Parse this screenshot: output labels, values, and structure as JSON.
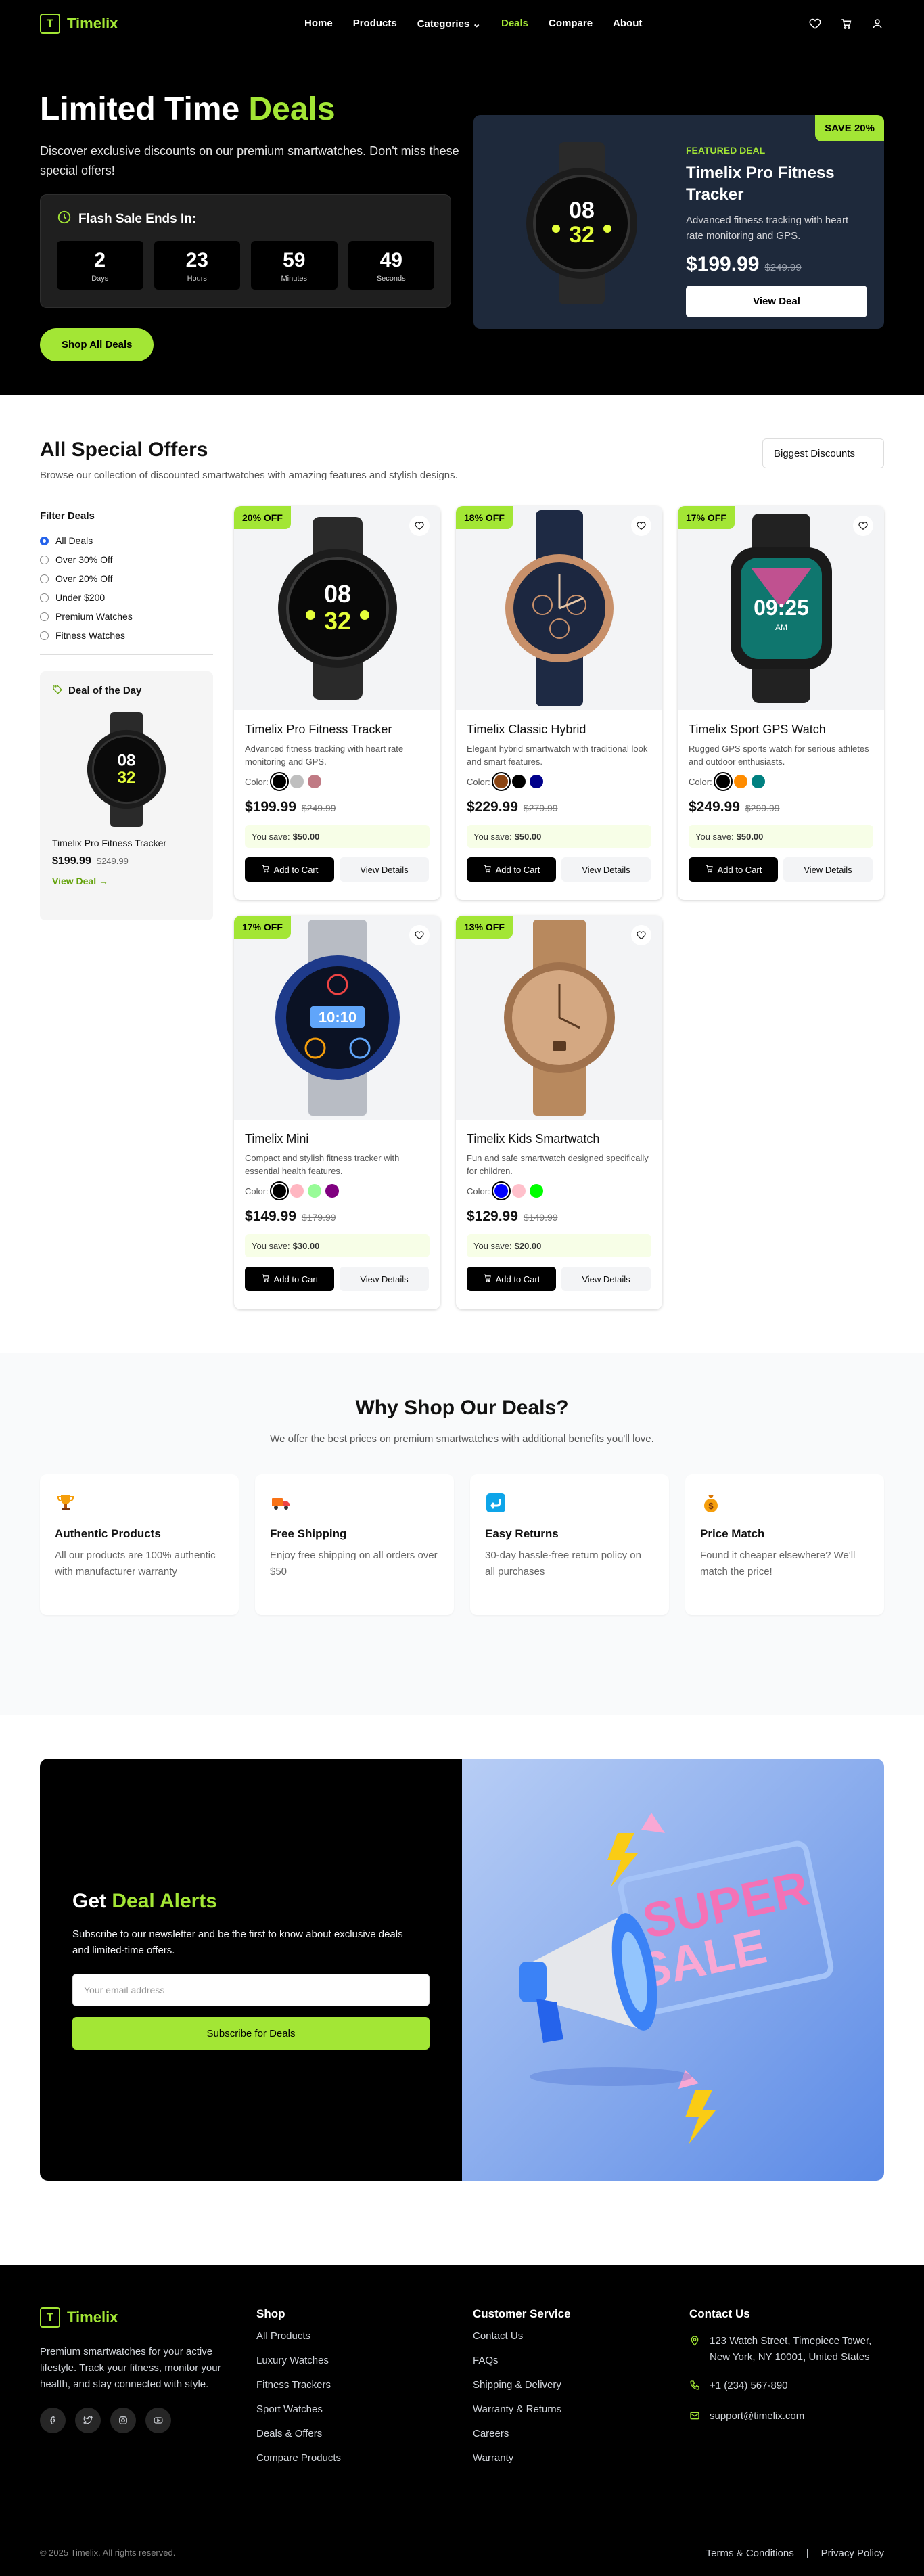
{
  "brand": {
    "logo_letter": "T",
    "name": "Timelix",
    "accent": "#a3e635"
  },
  "nav": {
    "links": [
      "Home",
      "Products",
      "Categories",
      "Deals",
      "Compare",
      "About"
    ],
    "active": "Deals",
    "icons": [
      "heart-icon",
      "cart-icon",
      "user-icon"
    ]
  },
  "hero": {
    "title_part1": "Limited Time",
    "title_part2": "Deals",
    "description": "Discover exclusive discounts on our premium smartwatches. Don't miss these special offers!",
    "timer_title": "Flash Sale Ends In:",
    "timer": [
      {
        "value": "2",
        "label": "Days"
      },
      {
        "value": "23",
        "label": "Hours"
      },
      {
        "value": "59",
        "label": "Minutes"
      },
      {
        "value": "49",
        "label": "Seconds"
      }
    ],
    "cta": "Shop All Deals",
    "featured": {
      "badge": "SAVE 20%",
      "tag": "FEATURED DEAL",
      "name": "Timelix Pro Fitness Tracker",
      "description": "Advanced fitness tracking with heart rate monitoring and GPS.",
      "price": "$199.99",
      "old_price": "$249.99",
      "button": "View Deal"
    }
  },
  "offers": {
    "title": "All Special Offers",
    "subtitle": "Browse our collection of discounted smartwatches with amazing features and stylish designs.",
    "sort_label": "Biggest Discounts",
    "filters": {
      "title": "Filter Deals",
      "options": [
        "All Deals",
        "Over 30% Off",
        "Over 20% Off",
        "Under $200",
        "Premium Watches",
        "Fitness Watches"
      ],
      "selected": "All Deals"
    },
    "deal_of_day": {
      "title": "Deal of the Day",
      "name": "Timelix Pro Fitness Tracker",
      "price": "$199.99",
      "old_price": "$249.99",
      "link": "View Deal →"
    },
    "color_label": "Color:",
    "save_prefix": "You save:",
    "add_label": "Add to Cart",
    "details_label": "View Details",
    "products": [
      {
        "discount": "20% OFF",
        "name": "Timelix Pro Fitness Tracker",
        "description": "Advanced fitness tracking with heart rate monitoring and GPS.",
        "colors": [
          "#000000",
          "#bfbfbf",
          "#c07a84"
        ],
        "price": "$199.99",
        "old_price": "$249.99",
        "save": "$50.00",
        "image": "sport-black-watch"
      },
      {
        "discount": "18% OFF",
        "name": "Timelix Classic Hybrid",
        "description": "Elegant hybrid smartwatch with traditional look and smart features.",
        "colors": [
          "#8b4513",
          "#000000",
          "#00008b"
        ],
        "price": "$229.99",
        "old_price": "$279.99",
        "save": "$50.00",
        "image": "classic-hybrid-watch"
      },
      {
        "discount": "17% OFF",
        "name": "Timelix Sport GPS Watch",
        "description": "Rugged GPS sports watch for serious athletes and outdoor enthusiasts.",
        "colors": [
          "#000000",
          "#ff8c00",
          "#008080"
        ],
        "price": "$249.99",
        "old_price": "$299.99",
        "save": "$50.00",
        "image": "square-gps-watch"
      },
      {
        "discount": "17% OFF",
        "name": "Timelix Mini",
        "description": "Compact and stylish fitness tracker with essential health features.",
        "colors": [
          "#000000",
          "#ffb6c1",
          "#98fb98",
          "#800080"
        ],
        "price": "$149.99",
        "old_price": "$179.99",
        "save": "$30.00",
        "image": "blue-steel-watch"
      },
      {
        "discount": "13% OFF",
        "name": "Timelix Kids Smartwatch",
        "description": "Fun and safe smartwatch designed specifically for children.",
        "colors": [
          "#0000ff",
          "#ffc0cb",
          "#00ff00"
        ],
        "price": "$129.99",
        "old_price": "$149.99",
        "save": "$20.00",
        "image": "gold-dress-watch"
      }
    ]
  },
  "why": {
    "title": "Why Shop Our Deals?",
    "subtitle": "We offer the best prices on premium smartwatches with additional benefits you'll love.",
    "features": [
      {
        "icon": "trophy-icon",
        "title": "Authentic Products",
        "text": "All our products are 100% authentic with manufacturer warranty"
      },
      {
        "icon": "truck-icon",
        "title": "Free Shipping",
        "text": "Enjoy free shipping on all orders over $50"
      },
      {
        "icon": "return-icon",
        "title": "Easy Returns",
        "text": "30-day hassle-free return policy on all purchases"
      },
      {
        "icon": "money-bag-icon",
        "title": "Price Match",
        "text": "Found it cheaper elsewhere? We'll match the price!"
      }
    ]
  },
  "newsletter": {
    "title_part1": "Get",
    "title_part2": "Deal Alerts",
    "text": "Subscribe to our newsletter and be the first to know about exclusive deals and limited-time offers.",
    "placeholder": "Your email address",
    "button": "Subscribe for Deals",
    "image_text_1": "SUPER",
    "image_text_2": "SALE"
  },
  "footer": {
    "tagline": "Premium smartwatches for your active lifestyle. Track your fitness, monitor your health, and stay connected with style.",
    "socials": [
      "facebook-icon",
      "twitter-icon",
      "instagram-icon",
      "youtube-icon"
    ],
    "shop": {
      "title": "Shop",
      "links": [
        "All Products",
        "Luxury Watches",
        "Fitness Trackers",
        "Sport Watches",
        "Deals & Offers",
        "Compare Products"
      ]
    },
    "service": {
      "title": "Customer Service",
      "links": [
        "Contact Us",
        "FAQs",
        "Shipping & Delivery",
        "Warranty & Returns",
        "Careers",
        "Warranty"
      ]
    },
    "contact": {
      "title": "Contact Us",
      "address": "123 Watch Street, Timepiece Tower, New York, NY 10001, United States",
      "phone": "+1 (234) 567-890",
      "email": "support@timelix.com"
    },
    "copyright": "© 2025 Timelix. All rights reserved.",
    "bottom_links": [
      "Terms & Conditions",
      "|",
      "Privacy Policy"
    ]
  }
}
